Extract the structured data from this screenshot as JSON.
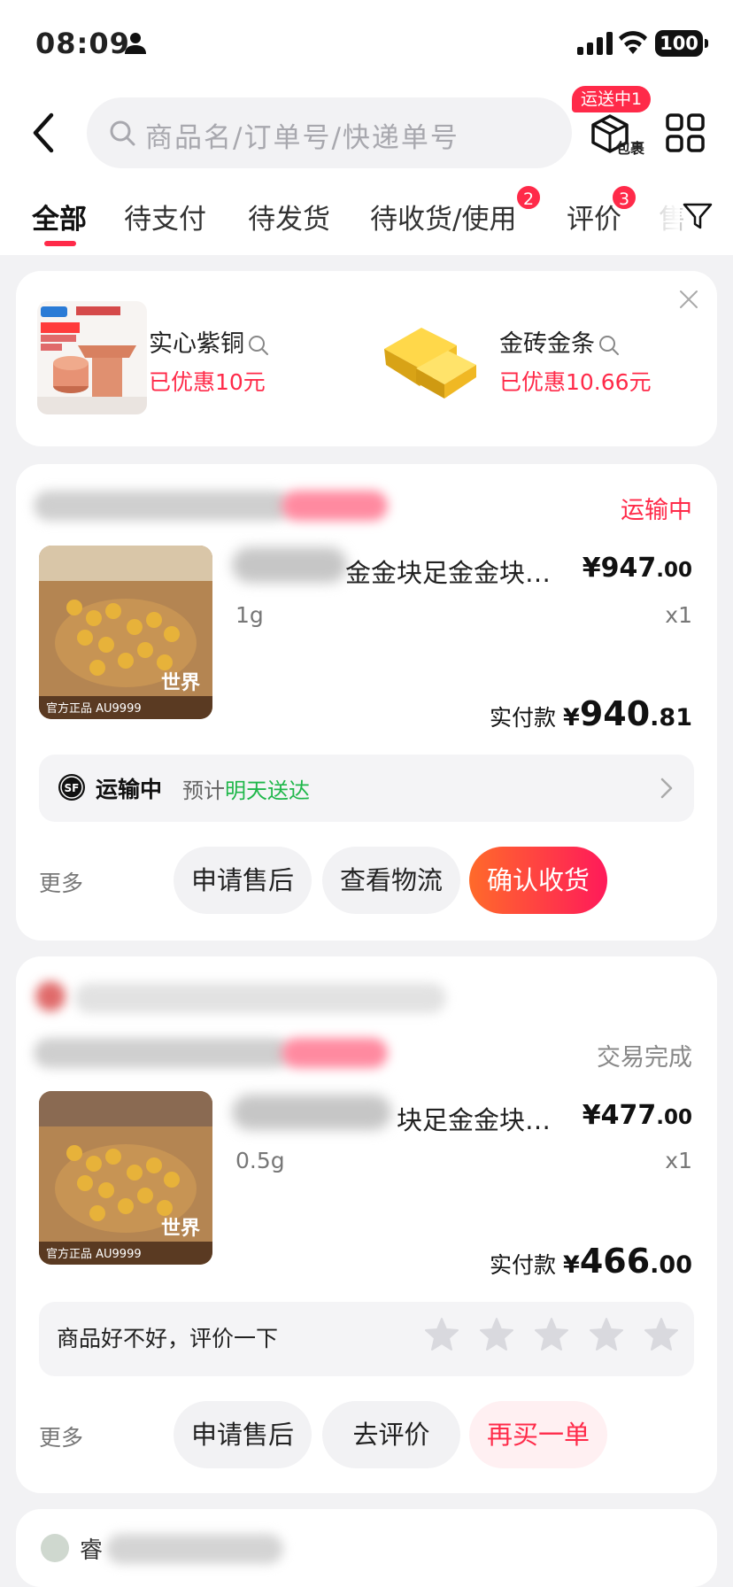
{
  "status_bar": {
    "time": "08:09",
    "battery": "100"
  },
  "header": {
    "search_placeholder": "商品名/订单号/快递单号",
    "package_badge": "运送中1",
    "package_label": "包裹"
  },
  "tabs": [
    {
      "label": "全部",
      "active": true
    },
    {
      "label": "待支付"
    },
    {
      "label": "待发货"
    },
    {
      "label": "待收货/使用",
      "badge": "2"
    },
    {
      "label": "评价",
      "badge": "3"
    },
    {
      "label": "售"
    }
  ],
  "promo": {
    "items": [
      {
        "title": "实心紫铜",
        "discount": "已优惠10元"
      },
      {
        "title": "金砖金条",
        "discount": "已优惠10.66元"
      }
    ]
  },
  "orders": [
    {
      "status": "运输中",
      "status_color": "#ff2a49",
      "product_title": "金金块足金金块…",
      "price_int": "¥947",
      "price_dec": ".00",
      "spec": "1g",
      "qty": "x1",
      "paid_label": "实付款",
      "paid_currency": "¥",
      "paid_int": "940",
      "paid_dec": ".81",
      "logistics": {
        "status": "运输中",
        "est_prefix": "预计",
        "est_value": "明天送达"
      },
      "more": "更多",
      "buttons": [
        "申请售后",
        "查看物流",
        "确认收货"
      ]
    },
    {
      "status": "交易完成",
      "status_color": "#888888",
      "product_title": "块足金金块…",
      "price_int": "¥477",
      "price_dec": ".00",
      "spec": "0.5g",
      "qty": "x1",
      "paid_label": "实付款",
      "paid_currency": "¥",
      "paid_int": "466",
      "paid_dec": ".00",
      "review_prompt": "商品好不好，评价一下",
      "more": "更多",
      "buttons": [
        "申请售后",
        "去评价",
        "再买一单"
      ]
    }
  ],
  "next_card": {
    "shop_name": "睿"
  },
  "colors": {
    "accent": "#ff2a49",
    "green": "#1fb74a",
    "background": "#f2f2f4"
  }
}
